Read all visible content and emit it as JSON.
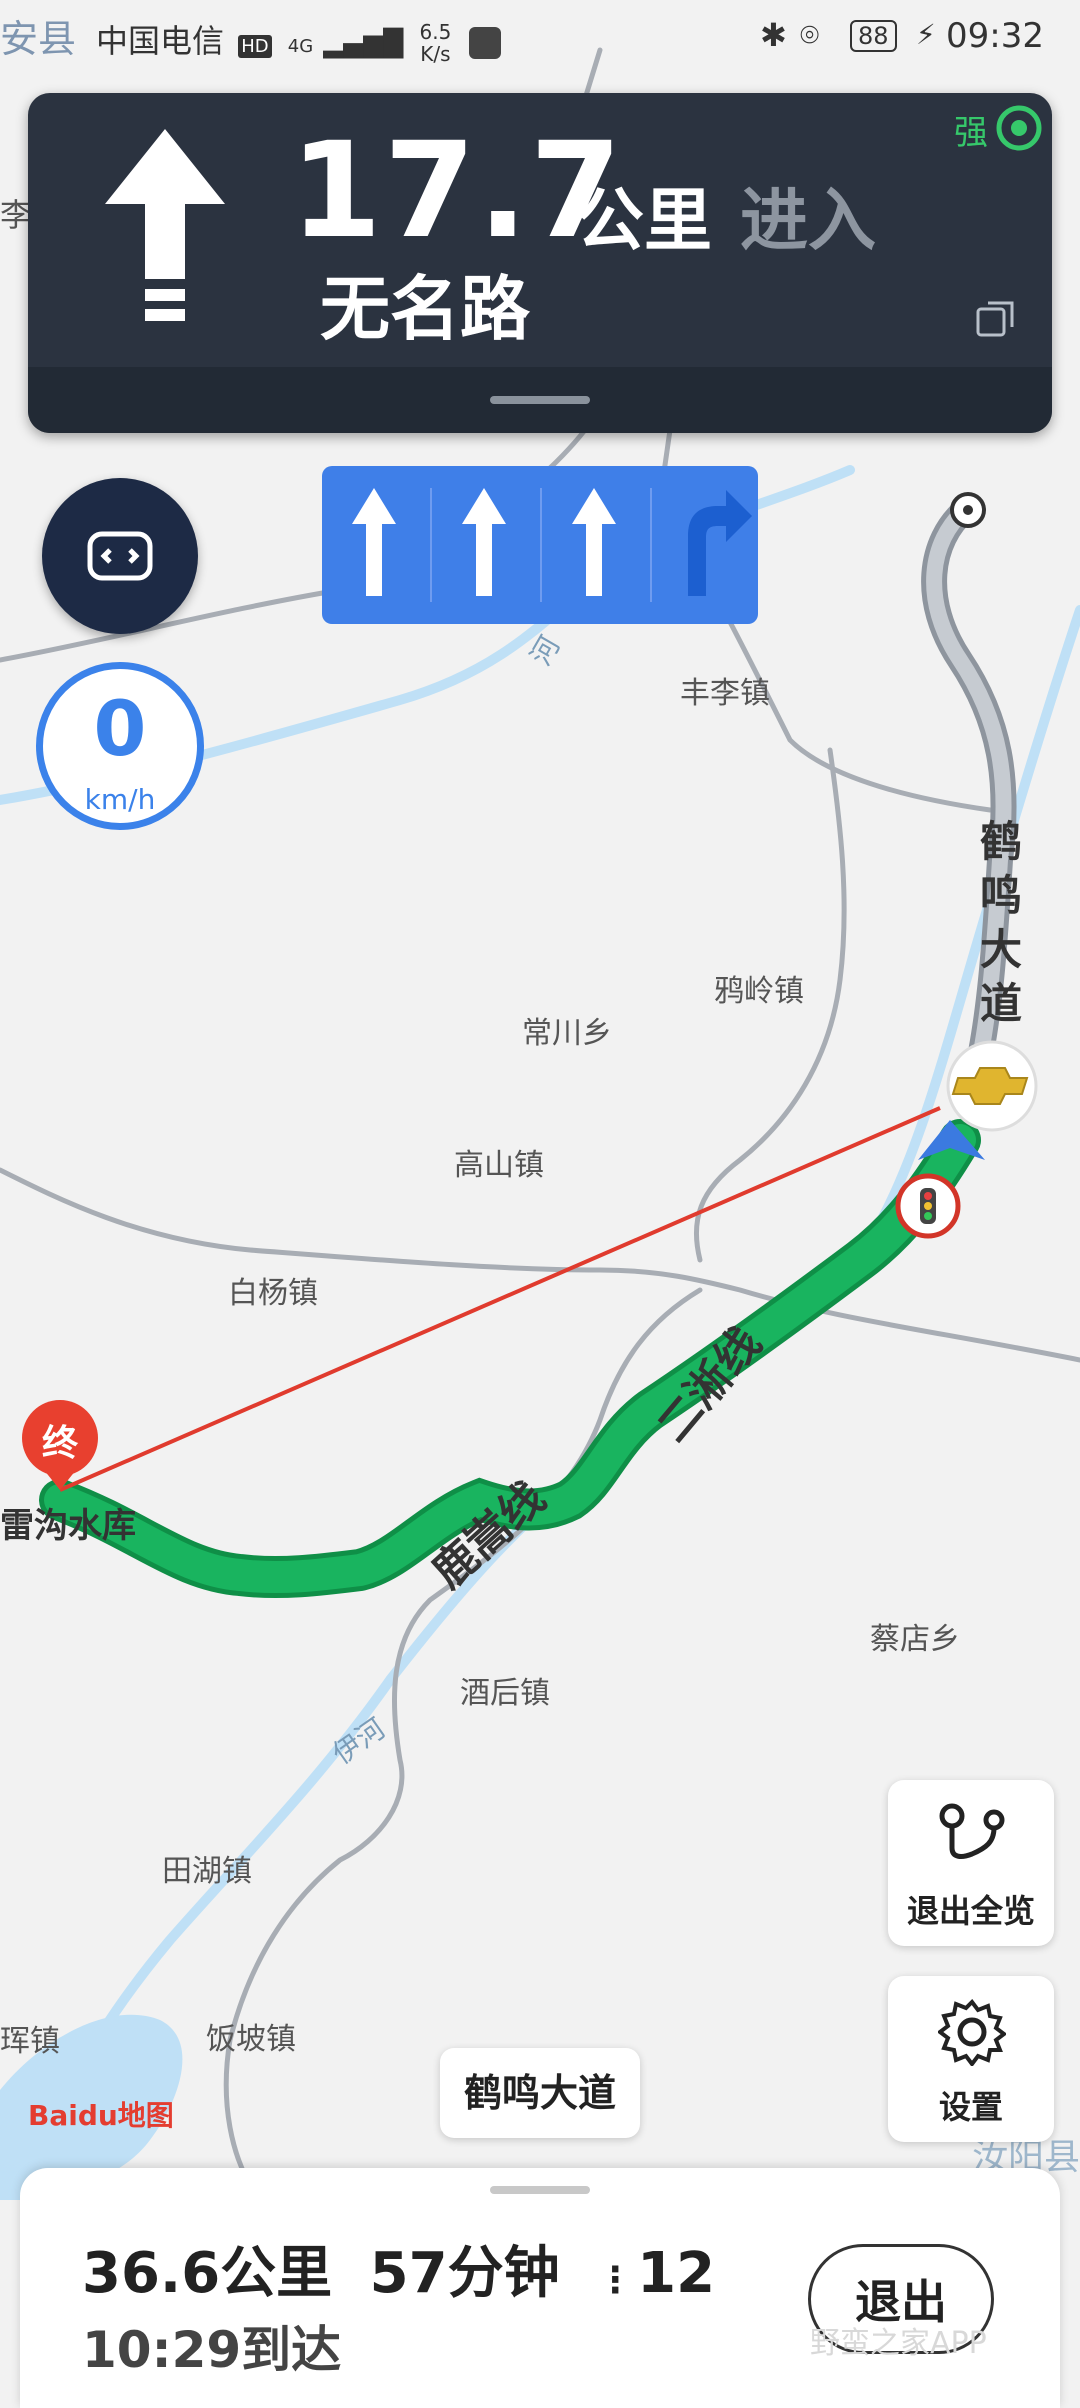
{
  "status_bar": {
    "carrier": "中国电信",
    "hd": "HD",
    "net_type": "4G",
    "speed_value": "6.5",
    "speed_unit": "K/s",
    "battery": "88",
    "time": "09:32"
  },
  "nav_banner": {
    "distance_value": "17.7",
    "distance_unit": "公里",
    "action": "进入",
    "road_name": "无名路",
    "signal_label": "强"
  },
  "lane_guidance": {
    "lanes": [
      "straight",
      "straight",
      "straight",
      "right-turn"
    ]
  },
  "speedometer": {
    "value": "0",
    "unit": "km/h"
  },
  "map_labels": {
    "top_left_county": "安县",
    "left_edge_label": "李",
    "fengli": "丰李镇",
    "river_label": "河",
    "yaling": "鸦岭镇",
    "changchuan": "常川乡",
    "gaoshan": "高山镇",
    "baiyang": "白杨镇",
    "heming_road": "鹤鸣大道",
    "erzhe_line": "二淅线",
    "luxiao_line": "鹿嵩线",
    "reservoir": "雷沟水库",
    "jiuhou": "酒后镇",
    "yihe": "伊河",
    "caidian": "蔡店乡",
    "tianhu": "田湖镇",
    "fanpo": "饭坡镇",
    "hui_town": "珲镇",
    "ruyang": "汝阳县",
    "destination_marker": "终"
  },
  "map_overlay": {
    "current_road_chip": "鹤鸣大道",
    "baidu_logo": "Baidu地图"
  },
  "side_buttons": {
    "exit_overview": "退出全览",
    "settings": "设置"
  },
  "trip_summary": {
    "distance": "36.6公里",
    "duration": "57分钟",
    "traffic_lights": "12",
    "arrival": "10:29到达",
    "exit_label": "退出"
  },
  "watermark": "野蛮之家APP",
  "colors": {
    "route_green": "#19b45f",
    "nav_banner_bg": "#2b3340",
    "lane_blue": "#3f7fe8",
    "speed_blue": "#3b82ea",
    "destination_red": "#e8402f",
    "signal_green": "#36c86b"
  }
}
